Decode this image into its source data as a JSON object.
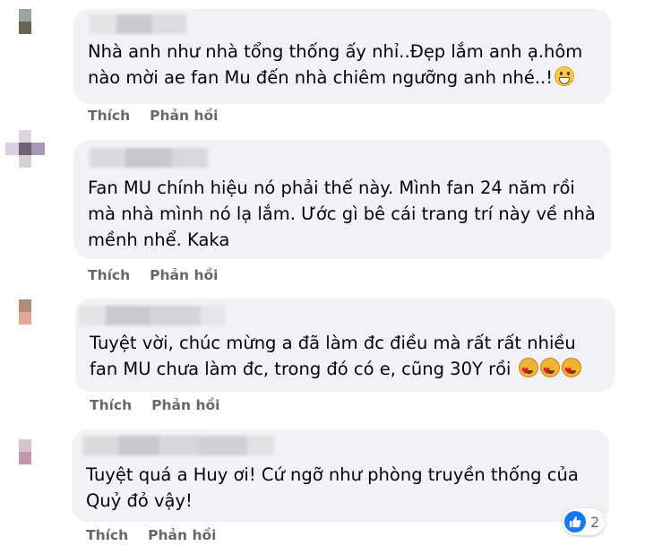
{
  "actions": {
    "like_label": "Thích",
    "reply_label": "Phản hồi"
  },
  "comments": [
    {
      "text": "Nhà anh như nhà tổng thống ấy nhỉ..Đẹp lắm anh ạ.hôm\nnào mời ae fan Mu đến nhà chiêm ngưỡng anh nhé..!",
      "emoji": "grinning-face-icon"
    },
    {
      "text": "Fan MU chính hiệu nó phải thế này. Mình fan 24 năm rồi\nmà nhà mình nó lạ lắm. Ước gì bê cái trang trí này về nhà\nmềnh nhể. Kaka"
    },
    {
      "text": "Tuyệt vời, chúc mừng a đã làm đc điều mà rất rất nhiều\nfan MU chưa làm đc, trong đó có e, cũng 30Y rồi",
      "emoji": "heart-eyes-icon"
    },
    {
      "text": "Tuyệt quá a Huy ơi! Cứ ngỡ như phòng truyền thống của\nQuỷ đỏ vậy!",
      "reactions": {
        "icon": "like-thumb-icon",
        "count": "2"
      }
    }
  ],
  "colors": {
    "bubble": "#f0f2f5",
    "action_text": "#65676b",
    "like_blue": "#1877f2"
  }
}
